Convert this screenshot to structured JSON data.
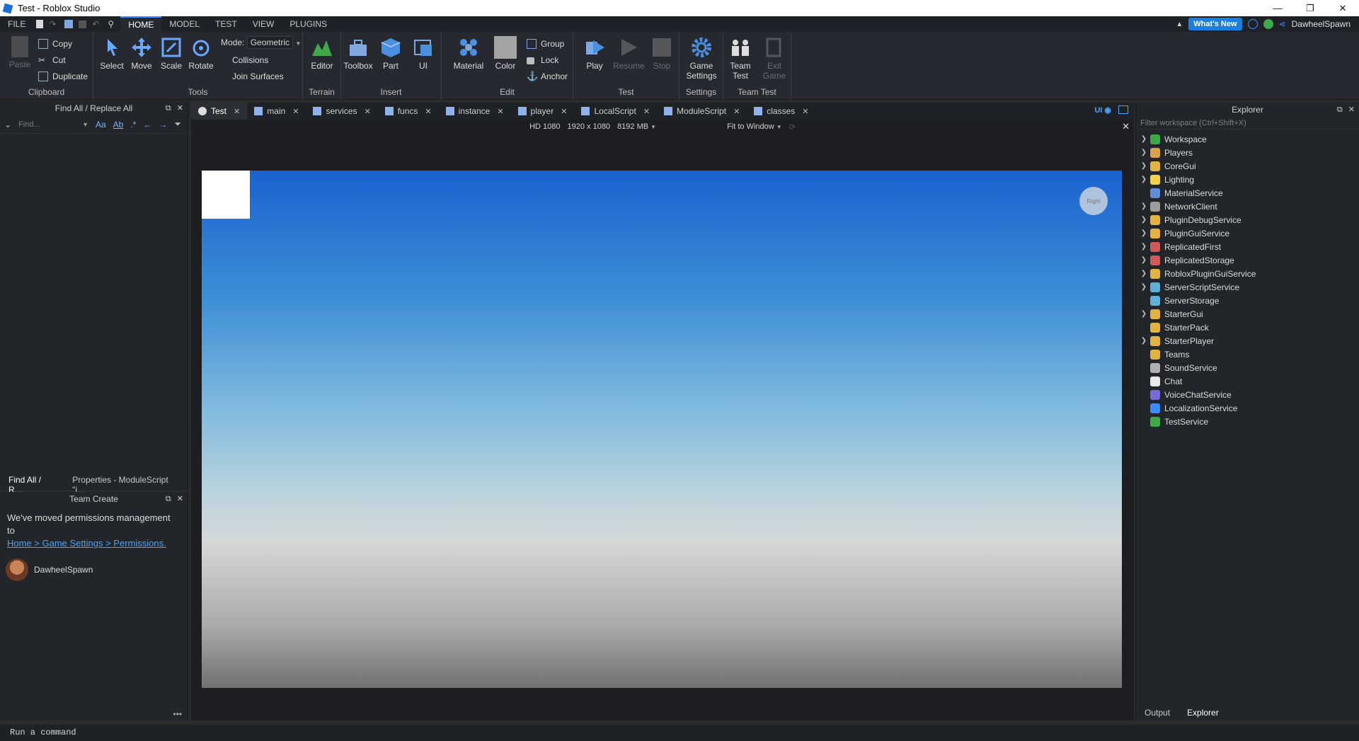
{
  "window": {
    "title": "Test - Roblox Studio",
    "minimize": "—",
    "restore": "❐",
    "close": "✕"
  },
  "menu": {
    "tabs": [
      "FILE",
      "HOME",
      "MODEL",
      "TEST",
      "VIEW",
      "PLUGINS"
    ],
    "whats_new": "What's New",
    "username": "DawheelSpawn"
  },
  "ribbon": {
    "clipboard": {
      "paste": "Paste",
      "copy": "Copy",
      "cut": "Cut",
      "duplicate": "Duplicate",
      "label": "Clipboard"
    },
    "tools": {
      "select": "Select",
      "move": "Move",
      "scale": "Scale",
      "rotate": "Rotate",
      "mode_label": "Mode:",
      "mode_value": "Geometric",
      "collisions": "Collisions",
      "join_surfaces": "Join Surfaces",
      "label": "Tools"
    },
    "terrain": {
      "editor": "Editor",
      "label": "Terrain"
    },
    "insert": {
      "toolbox": "Toolbox",
      "part": "Part",
      "ui": "UI",
      "label": "Insert"
    },
    "edit": {
      "material": "Material",
      "color": "Color",
      "group": "Group",
      "lock": "Lock",
      "anchor": "Anchor",
      "label": "Edit"
    },
    "test": {
      "play": "Play",
      "resume": "Resume",
      "stop": "Stop",
      "label": "Test"
    },
    "settings": {
      "game_settings_1": "Game",
      "game_settings_2": "Settings",
      "label": "Settings"
    },
    "team_test": {
      "team_test_1": "Team",
      "team_test_2": "Test",
      "exit_game_1": "Exit",
      "exit_game_2": "Game",
      "label": "Team Test"
    }
  },
  "find_panel": {
    "title": "Find All / Replace All",
    "placeholder": "Find...",
    "options": [
      "Aa",
      "Ab",
      ".*"
    ],
    "bottom_tabs": [
      "Find All / R...",
      "Properties - ModuleScript \"i..."
    ]
  },
  "team_create": {
    "title": "Team Create",
    "message": "We've moved permissions management to",
    "link": "Home > Game Settings > Permissions.",
    "user": "DawheelSpawn"
  },
  "doc_tabs": [
    "Test",
    "main",
    "services",
    "funcs",
    "instance",
    "player",
    "LocalScript",
    "ModuleScript",
    "classes"
  ],
  "doc_tabs_ui": "UI",
  "viewport": {
    "resolution": "HD 1080",
    "size": "1920 x 1080",
    "memory": "8192 MB",
    "fit": "Fit to Window",
    "cube_label": "Right"
  },
  "explorer": {
    "title": "Explorer",
    "filter_placeholder": "Filter workspace (Ctrl+Shift+X)",
    "items": [
      {
        "label": "Workspace",
        "expandable": true,
        "color": "#3ea84a"
      },
      {
        "label": "Players",
        "expandable": true,
        "color": "#d8a24a"
      },
      {
        "label": "CoreGui",
        "expandable": true,
        "color": "#e3b341"
      },
      {
        "label": "Lighting",
        "expandable": true,
        "color": "#f1d24b"
      },
      {
        "label": "MaterialService",
        "expandable": false,
        "color": "#5f8fd8"
      },
      {
        "label": "NetworkClient",
        "expandable": true,
        "color": "#9c9c9c"
      },
      {
        "label": "PluginDebugService",
        "expandable": true,
        "color": "#e3b341"
      },
      {
        "label": "PluginGuiService",
        "expandable": true,
        "color": "#e3b341"
      },
      {
        "label": "ReplicatedFirst",
        "expandable": true,
        "color": "#d05a5a"
      },
      {
        "label": "ReplicatedStorage",
        "expandable": true,
        "color": "#d05a5a"
      },
      {
        "label": "RobloxPluginGuiService",
        "expandable": true,
        "color": "#e3b341"
      },
      {
        "label": "ServerScriptService",
        "expandable": true,
        "color": "#5fb0d8"
      },
      {
        "label": "ServerStorage",
        "expandable": false,
        "color": "#5fb0d8"
      },
      {
        "label": "StarterGui",
        "expandable": true,
        "color": "#e3b341"
      },
      {
        "label": "StarterPack",
        "expandable": false,
        "color": "#e3b341"
      },
      {
        "label": "StarterPlayer",
        "expandable": true,
        "color": "#e3b341"
      },
      {
        "label": "Teams",
        "expandable": false,
        "color": "#e3b341"
      },
      {
        "label": "SoundService",
        "expandable": false,
        "color": "#b0b0b0"
      },
      {
        "label": "Chat",
        "expandable": false,
        "color": "#e8e8e8"
      },
      {
        "label": "VoiceChatService",
        "expandable": false,
        "color": "#7a6ad8"
      },
      {
        "label": "LocalizationService",
        "expandable": false,
        "color": "#3b8cff"
      },
      {
        "label": "TestService",
        "expandable": false,
        "color": "#3ea84a"
      }
    ],
    "bottom_tabs": [
      "Output",
      "Explorer"
    ]
  },
  "command_bar": {
    "placeholder": "Run a command"
  },
  "colors": {
    "accent": "#3b8cff",
    "ribbon_bg": "#26292f",
    "panel_bg": "#22252a"
  }
}
